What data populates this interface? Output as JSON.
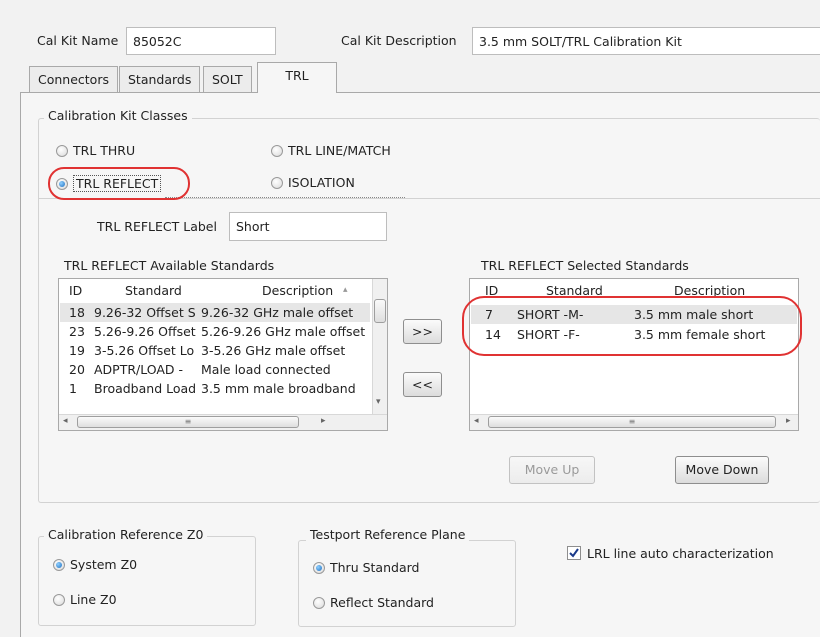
{
  "header": {
    "cal_kit_name_label": "Cal Kit Name",
    "cal_kit_name_value": "85052C",
    "cal_kit_description_label": "Cal Kit Description",
    "cal_kit_description_value": "3.5 mm SOLT/TRL Calibration Kit"
  },
  "tabs": [
    {
      "label": "Connectors"
    },
    {
      "label": "Standards"
    },
    {
      "label": "SOLT"
    },
    {
      "label": "TRL",
      "active": true
    }
  ],
  "classes": {
    "group_label": "Calibration Kit Classes",
    "options": [
      {
        "label": "TRL THRU",
        "selected": false
      },
      {
        "label": "TRL LINE/MATCH",
        "selected": false
      },
      {
        "label": "TRL REFLECT",
        "selected": true
      },
      {
        "label": "ISOLATION",
        "selected": false
      }
    ]
  },
  "reflect_label": {
    "label": "TRL REFLECT Label",
    "value": "Short"
  },
  "available": {
    "title": "TRL REFLECT Available Standards",
    "columns": [
      "ID",
      "Standard",
      "Description"
    ],
    "rows": [
      {
        "id": "18",
        "standard": "9.26-32 Offset S",
        "description": "9.26-32 GHz male offset",
        "selected": true
      },
      {
        "id": "23",
        "standard": "5.26-9.26 Offset",
        "description": "5.26-9.26 GHz male offset",
        "selected": false
      },
      {
        "id": "19",
        "standard": "3-5.26 Offset Lo",
        "description": "3-5.26 GHz male offset",
        "selected": false
      },
      {
        "id": "20",
        "standard": "ADPTR/LOAD -",
        "description": "Male load connected",
        "selected": false
      },
      {
        "id": "1",
        "standard": "Broadband Load",
        "description": "3.5 mm male broadband",
        "selected": false
      }
    ]
  },
  "selected": {
    "title": "TRL REFLECT Selected Standards",
    "columns": [
      "ID",
      "Standard",
      "Description"
    ],
    "rows": [
      {
        "id": "7",
        "standard": "SHORT -M-",
        "description": "3.5 mm male short",
        "selected": true
      },
      {
        "id": "14",
        "standard": "SHORT -F-",
        "description": "3.5 mm female short",
        "selected": false
      }
    ]
  },
  "buttons": {
    "add": ">>",
    "remove": "<<",
    "move_up": "Move Up",
    "move_up_enabled": false,
    "move_down": "Move Down",
    "move_down_enabled": true
  },
  "z0": {
    "group_label": "Calibration Reference Z0",
    "options": [
      {
        "label": "System Z0",
        "selected": true
      },
      {
        "label": "Line Z0",
        "selected": false
      }
    ]
  },
  "ref_plane": {
    "group_label": "Testport Reference Plane",
    "options": [
      {
        "label": "Thru Standard",
        "selected": true
      },
      {
        "label": "Reflect Standard",
        "selected": false
      }
    ]
  },
  "lrl": {
    "label": "LRL line auto characterization",
    "checked": true
  },
  "scroll_glyphs": {
    "left": "◂",
    "right": "▸",
    "up": "▴",
    "down": "▾",
    "grip": "≡"
  },
  "colors": {
    "highlight_circle": "#e03232",
    "radio_selected": "#1f6fc0"
  }
}
